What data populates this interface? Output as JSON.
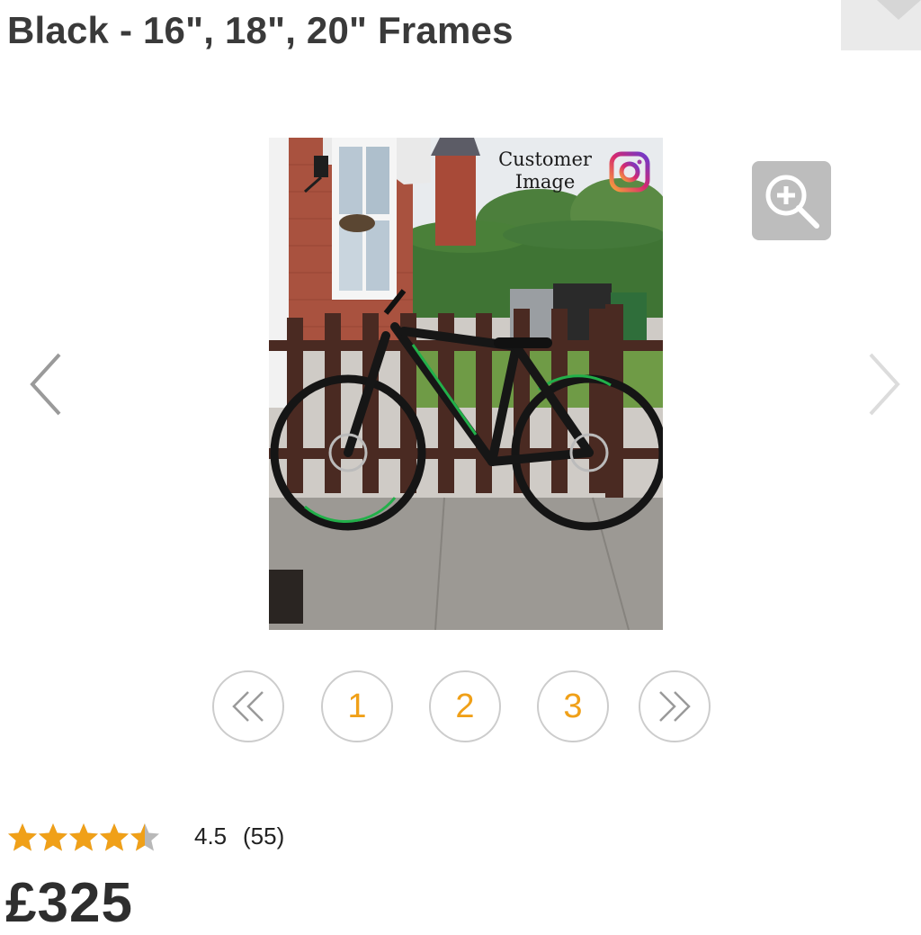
{
  "product": {
    "title": "Black - 16\", 18\", 20\" Frames",
    "price": "£325"
  },
  "gallery": {
    "image_caption": "Customer Image",
    "image_caption_line1": "Customer",
    "image_caption_line2": "Image",
    "zoom_icon": "zoom-in-icon",
    "prev_icon": "chevron-left-icon",
    "next_icon": "chevron-right-icon",
    "social_icon": "instagram-icon",
    "pagination": {
      "first_icon": "double-chevron-left-icon",
      "pages": [
        "1",
        "2",
        "3"
      ],
      "last_icon": "double-chevron-right-icon"
    }
  },
  "rating": {
    "value": "4.5",
    "count": "(55)",
    "stars_filled": 4.5,
    "stars_total": 5
  },
  "colors": {
    "accent": "#f0a018",
    "star": "#f0a018",
    "star_empty": "#b8b8b8",
    "zoom_button": "#bdbdbd",
    "pager_border": "#cccccc"
  }
}
